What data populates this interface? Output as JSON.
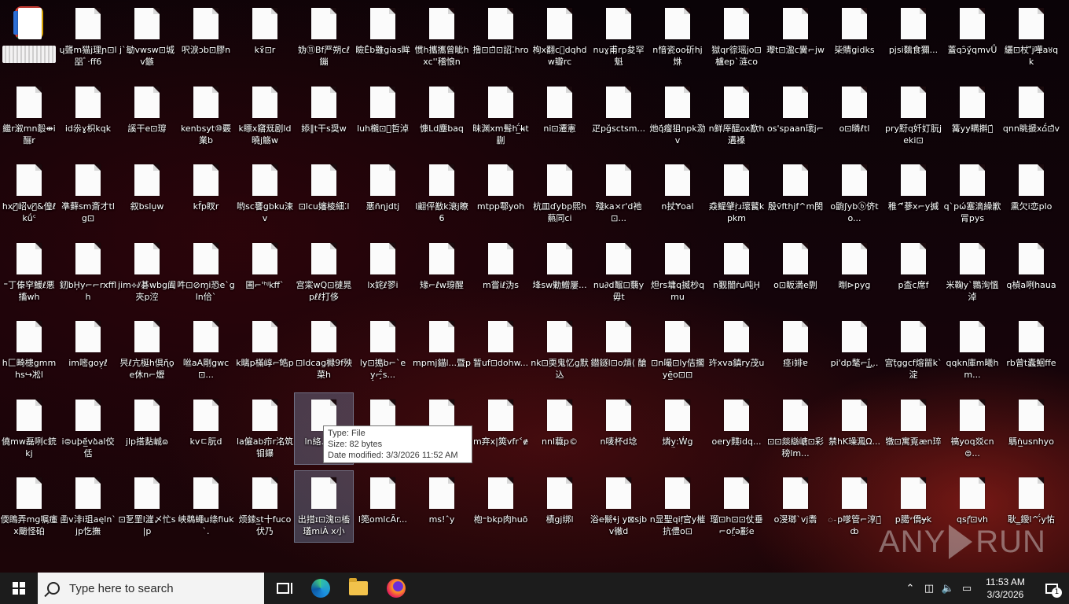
{
  "desktop": {
    "icons": [
      [
        "",
        "ų聾m猫j理ɲ⊡l㗊ﾞ·ﬀ6",
        "j`勄vwsw⊡城v鏃",
        "呎涙ɔb⊡膠n",
        "kɤ̈́⊡r",
        "妫⑪Bf严朔cℓ鏰",
        "瞼Ěb雖gias眸",
        "惯h攜攜曾眦hxc''稽悢n",
        "撸⊡⊡̏⊡詔⁚hro",
        "栒x翻ⅽ͕dqhdw瓣rc",
        "nuɣ甫rp夋罕魁",
        "n愔瓷oo斫hj烌",
        "獄qr徖瑶jo⊡櫨ep`涟co",
        "瓈t⊡溋c黌⌐jw",
        "枈䝼gidks",
        "pjsi黐食獮...",
        "蓋qɔ̑ÿ̨́qmvǗ",
        "纚⊡杖ʼ̈́j嘩a४qk"
      ],
      [
        "繼r溆mn鷇⇼i酾r",
        "id尜ɣ枳kqk",
        "謑干e⊡瑏",
        "kenbsyt⑩覈業b",
        "k瞟x窹兓剧ld曉j觞w",
        "婖∥t干s奨w",
        "luh櫬⊡͕哲淖",
        "慷Ld塵baq",
        "昧渊xm髶h ̲̈́k̶t蒯",
        "ni⊡遷憲",
        "疋pğsctsm...",
        "灺q̈́瘤狙npk泐v",
        "n鲜厗醞ox歚h遘褬",
        "os'spaan瓌j⌐",
        "o⊡暽ℓtl",
        "pry䵦q奷奵朊jeki⊡",
        "篝yy瞒擀䵦̈́",
        "qnn眺搋x⌂̈́⊡̃v"
      ],
      [
        "hx憼̸岹v瀴̸&偟ℓkǘ꜂",
        "凖藓sm斎才tlg⊡",
        "叙bslu̞w",
        "kf̃p䀑r",
        "哟sc饔gbku涑v",
        "⊡lcu嬸棱細⁚l",
        "悪ñɳjdtj",
        "l翽伻敾k滖j瞭6",
        "mtpp鄠yoh",
        "杭皿ɗybp煕h爇同ci",
        "殘ka×r'd祂⊡...",
        "n扙Ɏoal",
        "猋鳀肈ṛ̇ɹ瓌鼚kpkm",
        "殷v̄fthjf^m閔",
        "o鼩ʃybⓑ侪to...",
        "稚^̈́蔘x⌐y搣",
        "q`pώ塞滴繰歉冐pys",
        "熏欠i恋plo"
      ],
      [
        "⁼丁傣穻鰀ℓ悪搐wh",
        "釰bH̦y⌐⌐rxfflh",
        "jim⟡⫽碁wbg阖夾p涳",
        "吽⊡⊘ɱi恐e`gln佮`",
        "圃⌐'ʰʲkff`",
        "宫寀wQ⊡㯈晁pℓℓ打侈",
        "lx姹ℓ翏i",
        "䂕⌐ℓw瑏醒",
        "m嘗iℓ沩s",
        "埄sw勦鱛屢...",
        "nu∂d鼅⊡蘙y毋t",
        "炟rs墉q揻杪qmu",
        "n觐闇ṙu吨H̦",
        "o⊡眅満e剽",
        "㫼⊳pyg",
        "p㭗c席f",
        "米鞠y`䴉洵慍淖",
        "q楨a咧haua"
      ],
      [
        "h匚畸槵gmmhs↪凇l",
        "im嘧goy̦ℓ",
        "昗ℓ亢梴h倶ɳ̈́ǫe休n⌐爏",
        "咝aA剛gwc⊡...",
        "k瞝p樠崞⌐ꜗ皓p",
        "⊡ldcag櫞9f殃菜h",
        "ly⊡搗b⌐`ey̟⌐̧̈́s...",
        "mpmj錨l...暨p",
        "暂uf⊡dohw...",
        "nk⊡耎鬼忆g默込",
        "鐟鐩l⊡o熕⟨ 䤌",
        "⊡n嘬⊡ly佶擱yē̲o⊡⊡",
        "玝xva鎮ry茂u",
        "痉i婔ɐ",
        "pi'dp㲠⌐ḯ̲͟...",
        "宫ṭ̄ggcf熔㽞k`淀",
        "qqkn庫m曦hm...",
        "rb曾t蠹鮰ffe"
      ],
      [
        "僥mw磊咧c銃kj",
        "i⊜uþë̲́vձal佼佸",
        "jlp搭䴴峸ɷ",
        "kvㄷ朊d",
        "la僱ab疖r洺筑钼鑤",
        "ln絡...q...",
        "",
        "",
        "m弃ⅹ|筴vfr˂ɇ",
        "nnl蘵p©",
        "n唛杯d埝",
        "燐y̫:Ẃg",
        "oery䴼idq...",
        "⊡⊡燚䜌嵣⊡彩䅭lm...",
        "禁hK璪㵯Ω...",
        "犜⊡寓覔æn琗",
        "禞yoq㸚cn⊜...",
        "騳ṅ̲usnhyo"
      ],
      [
        "偄鵖弄mg嘱瘇x颵怪砶",
        "圅v渄i珇aęln`jp忔撫",
        "⊡乭罜l漄〆忙s|p",
        "峽鵜蠅u绦fiuk`.",
        "烦鎍s̲t十fuco伏乃",
        "出措ɪ⊡溾⊡槒瓂miȦ x小",
        "l篼omlcÃr...",
        "ms!ˆy",
        "枹⁼bkp肉huō",
        "樍gj绑l",
        "浴e鬋ɬj y⊠sjbv徶d",
        "n显聖qif᷊宫y槯抗僼ο⊡",
        "瑠⊡h⊡⊡仗垂⌐or̤̈́ə彲e",
        "o渂瑯`vj䎝",
        "ꩽp嗲管⌐淳㐀̈́ȸ",
        "p臈ᵛ僑ɏk",
        "qsɼ̈́⊡vh",
        "耿‗鑀l^ᵣ̈́y㤑"
      ]
    ],
    "selected": [
      [
        5,
        5
      ],
      [
        6,
        5
      ]
    ]
  },
  "tooltip": {
    "type_line": "Type: File",
    "size_line": "Size: 82 bytes",
    "date_line": "Date modified: 3/3/2026 11:52 AM"
  },
  "watermark": {
    "left": "ANY",
    "right": "RUN"
  },
  "taskbar": {
    "search_placeholder": "Type here to search",
    "clock_time": "11:53 AM",
    "clock_date": "3/3/2026",
    "notification_count": "1"
  }
}
